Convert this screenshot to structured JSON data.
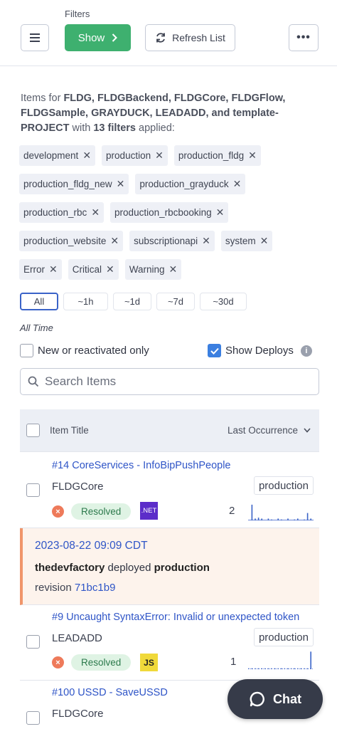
{
  "header": {
    "filters_label": "Filters",
    "show_label": "Show",
    "refresh_label": "Refresh List"
  },
  "summary": {
    "prefix": "Items for ",
    "projects": "FLDG, FLDGBackend, FLDGCore, FLDGFlow, FLDGSample, GRAYDUCK, LEADADD, and template-PROJECT",
    "middle": " with ",
    "filter_count": "13 filters",
    "suffix": " applied:"
  },
  "tags": [
    "development",
    "production",
    "production_fldg",
    "production_fldg_new",
    "production_grayduck",
    "production_rbc",
    "production_rbcbooking",
    "production_website",
    "subscriptionapi",
    "system",
    "Error",
    "Critical",
    "Warning"
  ],
  "time_range": {
    "options": [
      "All",
      "~1h",
      "~1d",
      "~7d",
      "~30d"
    ],
    "selected": "All",
    "label": "All Time"
  },
  "toggles": {
    "new_only_label": "New or reactivated only",
    "new_only_checked": false,
    "show_deploys_label": "Show Deploys",
    "show_deploys_checked": true
  },
  "search": {
    "placeholder": "Search Items"
  },
  "table": {
    "col_title": "Item Title",
    "col_sort": "Last Occurrence",
    "rows": [
      {
        "title": "#14 CoreServices - InfoBipPushPeople",
        "project": "FLDGCore",
        "environment": "production",
        "status": "Resolved",
        "language": ".NET",
        "count": "2",
        "spark": [
          0,
          0.85,
          0.1,
          0.15,
          0.1,
          0,
          0.1,
          0.05,
          0,
          0.1,
          0.05,
          0,
          0.1,
          0,
          0.05,
          0.1,
          0,
          0.05,
          0.4,
          0.1
        ]
      },
      {
        "type": "deploy",
        "date": "2023-08-22 09:09 CDT",
        "user": "thedevfactory",
        "action": " deployed ",
        "environment": "production",
        "revision_label": "revision ",
        "revision": "71bc1b9"
      },
      {
        "title": "#9 Uncaught SyntaxError: Invalid or unexpected token",
        "project": "LEADADD",
        "environment": "production",
        "status": "Resolved",
        "language": "JS",
        "count": "1",
        "spark": [
          0.05,
          0.05,
          0.05,
          0.05,
          0.05,
          0.05,
          0.05,
          0.05,
          0.05,
          0.05,
          0.05,
          0.05,
          0.05,
          0.05,
          0.05,
          0.05,
          0.05,
          0.05,
          0.05,
          0.95
        ]
      },
      {
        "title": "#100 USSD - SaveUSSD",
        "project": "FLDGCore"
      }
    ]
  },
  "chat": {
    "label": "Chat"
  },
  "colors": {
    "primary_green": "#3eb06f",
    "link_blue": "#2f55c7",
    "deploy_accent": "#f0956a",
    "resolved_bg": "#dff3e4"
  }
}
